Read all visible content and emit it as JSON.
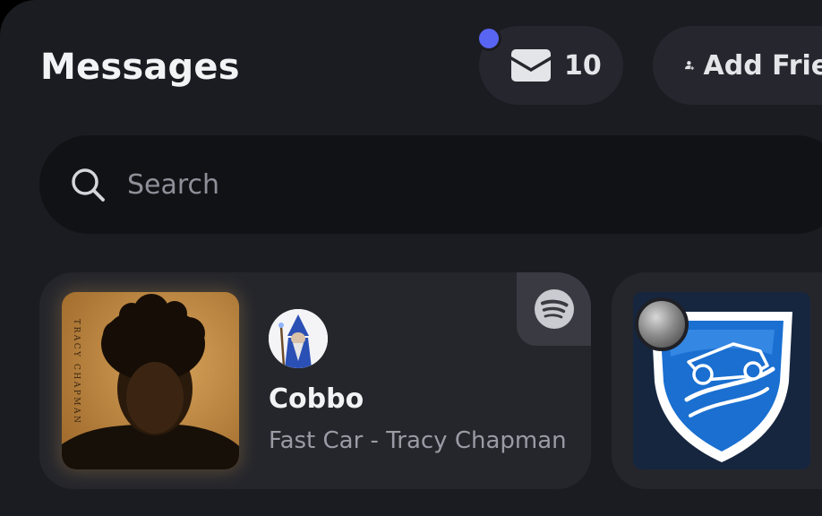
{
  "header": {
    "title": "Messages",
    "inbox_count": "10",
    "add_friend_label": "Add Friend"
  },
  "search": {
    "placeholder": "Search"
  },
  "activity_cards": [
    {
      "user_name": "Cobbo",
      "track": "Fast Car - Tracy Chapman",
      "album_spine_text": "TRACY CHAPMAN",
      "service_icon": "spotify-icon"
    },
    {
      "game_icon": "rocket-league-icon"
    }
  ],
  "colors": {
    "background": "#1b1c21",
    "pill": "#26272e",
    "search": "#111216",
    "card": "#25262c",
    "notification_dot": "#5865f2"
  }
}
